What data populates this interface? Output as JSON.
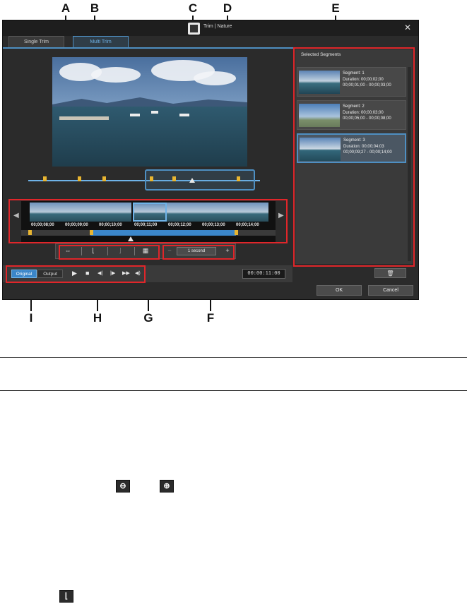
{
  "callouts": {
    "a": "A",
    "b": "B",
    "c": "C",
    "d": "D",
    "e": "E",
    "f": "F",
    "g": "G",
    "h": "H",
    "i": "I"
  },
  "window": {
    "title": "Trim | Nature",
    "close_label": "✕"
  },
  "tabs": [
    {
      "label": "Single Trim",
      "active": false
    },
    {
      "label": "Multi Trim",
      "active": true
    }
  ],
  "filmstrip": {
    "time_labels": [
      "00;00;08;00",
      "00;00;09;00",
      "00;00;10;00",
      "00;00;11;00",
      "00;00;12;00",
      "00;00;13;00",
      "00;00;14;00"
    ],
    "left_arrow": "◀",
    "right_arrow": "▶"
  },
  "toolbar": {
    "zoom_value": "1 second",
    "zoom_out_label": "−",
    "zoom_in_label": "+"
  },
  "playback": {
    "original_label": "Original",
    "output_label": "Output",
    "play": "▶",
    "stop": "■",
    "prev_frame": "◀|",
    "next_frame": "|▶",
    "fast_forward": "▶▶",
    "volume": "◀)",
    "timecode": "00:00:11:00"
  },
  "selected_segments": {
    "title": "Selected Segments",
    "segments": [
      {
        "name": "Segment: 1",
        "duration": "Duration: 00;00;02;00",
        "range": "00;00;01;00 - 00;00;03;00"
      },
      {
        "name": "Segment: 2",
        "duration": "Duration: 00;00;03;00",
        "range": "00;00;05;00 - 00;00;08;00"
      },
      {
        "name": "Segment: 3",
        "duration": "Duration: 00;00;04;03",
        "range": "00;00;09;27 - 00;00;14;00"
      }
    ],
    "delete_icon": "trash-icon"
  },
  "buttons": {
    "ok": "OK",
    "cancel": "Cancel"
  },
  "colors": {
    "accent": "#4e8fc2",
    "callout_red": "#e0262a",
    "marker": "#e8b531",
    "window_bg": "#2b2b2b"
  }
}
